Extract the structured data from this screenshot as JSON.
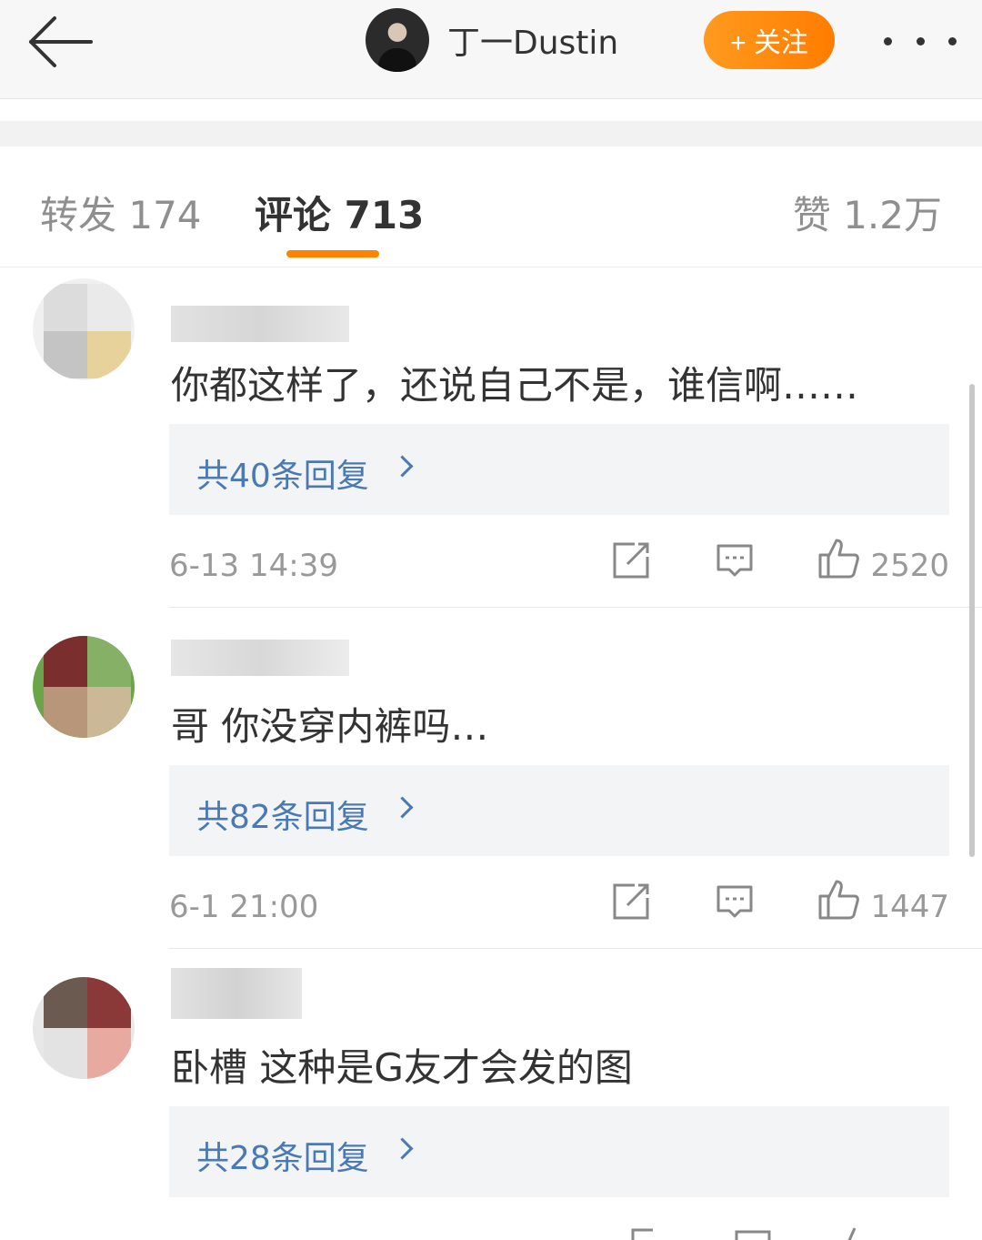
{
  "header": {
    "user_name": "丁一Dustin",
    "follow_label": "+ 关注"
  },
  "tabs": {
    "repost": "转发 174",
    "comment": "评论 713",
    "like": "赞 1.2万",
    "active": "comment"
  },
  "comments": [
    {
      "text": "你都这样了，还说自己不是，谁信啊……",
      "replies": "共40条回复",
      "time": "6-13 14:39",
      "likes": "2520"
    },
    {
      "text": "哥 你没穿内裤吗…",
      "replies": "共82条回复",
      "time": "6-1 21:00",
      "likes": "1447"
    },
    {
      "text": "卧槽 这种是G友才会发的图",
      "replies": "共28条回复",
      "time": "",
      "likes": ""
    }
  ],
  "colors": {
    "accent": "#ff8200",
    "link": "#4a79b4",
    "text": "#333333",
    "muted": "#999999"
  },
  "icons": [
    "back-arrow-icon",
    "more-icon",
    "share-icon",
    "comment-icon",
    "like-icon",
    "chevron-right-icon"
  ]
}
